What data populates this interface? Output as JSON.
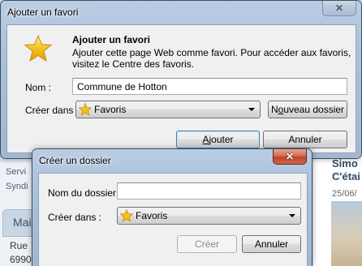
{
  "background": {
    "left_lines": [
      "Servi",
      "Syndi"
    ],
    "left_tab": "Mai",
    "left_address": [
      "Rue",
      "6990"
    ],
    "right_title_lines": [
      "Simo",
      "C'étai"
    ],
    "right_date": "25/06/"
  },
  "add_favorite_dialog": {
    "title": "Ajouter un favori",
    "close_glyph": "✕",
    "heading": "Ajouter un favori",
    "description_line1": "Ajouter cette page Web comme favori. Pour accéder aux favoris,",
    "description_line2": "visitez le Centre des favoris.",
    "name_label": "Nom :",
    "name_value": "Commune de Hotton",
    "create_in_label": "Créer dans :",
    "create_in_value": "Favoris",
    "new_folder_button": {
      "pre": "N",
      "underlined": "o",
      "post": "uveau dossier"
    },
    "add_button": {
      "pre": "",
      "underlined": "A",
      "post": "jouter"
    },
    "cancel_button": "Annuler",
    "icon": "star-icon"
  },
  "create_folder_dialog": {
    "title": "Créer un dossier",
    "close_glyph": "✕",
    "folder_name_label": "Nom du dossier :",
    "folder_name_value": "",
    "create_in_label": "Créer dans :",
    "create_in_value": "Favoris",
    "create_button": "Créer",
    "cancel_button": "Annuler"
  },
  "colors": {
    "star_fill": "#f6c31c",
    "close_button_red": "#c0432b",
    "window_frame": "#a9c0d9"
  }
}
